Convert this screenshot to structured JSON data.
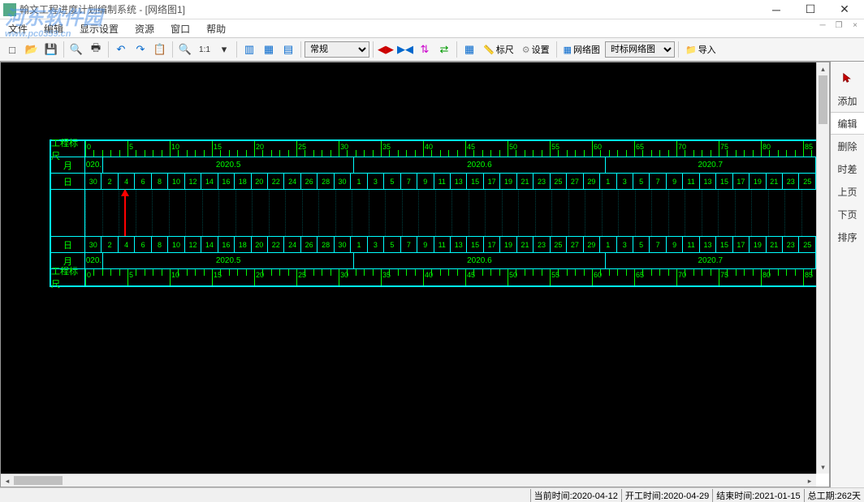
{
  "window": {
    "title": "翰文工程进度计划编制系统 - [网络图1]"
  },
  "menu": {
    "file": "文件",
    "edit": "编辑",
    "display": "显示设置",
    "resource": "资源",
    "window": "窗口",
    "help": "帮助"
  },
  "toolbar": {
    "style_combo": "常规",
    "ruler_btn": "标尺",
    "settings_btn": "设置",
    "netgraph_btn": "网络图",
    "timenet_combo": "时标网络图",
    "import_btn": "导入"
  },
  "timeline": {
    "ruler_label": "工程标尺",
    "month_label": "月",
    "day_label": "日",
    "ruler_marks": [
      "0",
      "5",
      "10",
      "15",
      "20",
      "25",
      "30",
      "35",
      "40",
      "45",
      "50",
      "55",
      "60",
      "65",
      "70",
      "75",
      "80",
      "85"
    ],
    "months_top": [
      "020.",
      "2020.5",
      "2020.6",
      "2020.7"
    ],
    "days_top": [
      "30",
      "2",
      "4",
      "6",
      "8",
      "10",
      "12",
      "14",
      "16",
      "18",
      "20",
      "22",
      "24",
      "26",
      "28",
      "30",
      "1",
      "3",
      "5",
      "7",
      "9",
      "11",
      "13",
      "15",
      "17",
      "19",
      "21",
      "23",
      "25",
      "27",
      "29",
      "1",
      "3",
      "5",
      "7",
      "9",
      "11",
      "13",
      "15",
      "17",
      "19",
      "21",
      "23",
      "25"
    ],
    "days_bottom": [
      "30",
      "2",
      "4",
      "6",
      "8",
      "10",
      "12",
      "14",
      "16",
      "18",
      "20",
      "22",
      "24",
      "26",
      "28",
      "30",
      "1",
      "3",
      "5",
      "7",
      "9",
      "11",
      "13",
      "15",
      "17",
      "19",
      "21",
      "23",
      "25",
      "27",
      "29",
      "1",
      "3",
      "5",
      "7",
      "9",
      "11",
      "13",
      "15",
      "17",
      "19",
      "21",
      "23",
      "25"
    ],
    "months_bottom": [
      "020.",
      "2020.5",
      "2020.6",
      "2020.7"
    ]
  },
  "side": {
    "add": "添加",
    "edit": "编辑",
    "delete": "删除",
    "slack": "时差",
    "prev": "上页",
    "next": "下页",
    "sort": "排序"
  },
  "status": {
    "current": "当前时间:2020-04-12",
    "start": "开工时间:2020-04-29",
    "end": "结束时间:2021-01-15",
    "total": "总工期:262天"
  },
  "watermark": {
    "main": "河东软件园",
    "sub": "www.pc0359.cn"
  }
}
